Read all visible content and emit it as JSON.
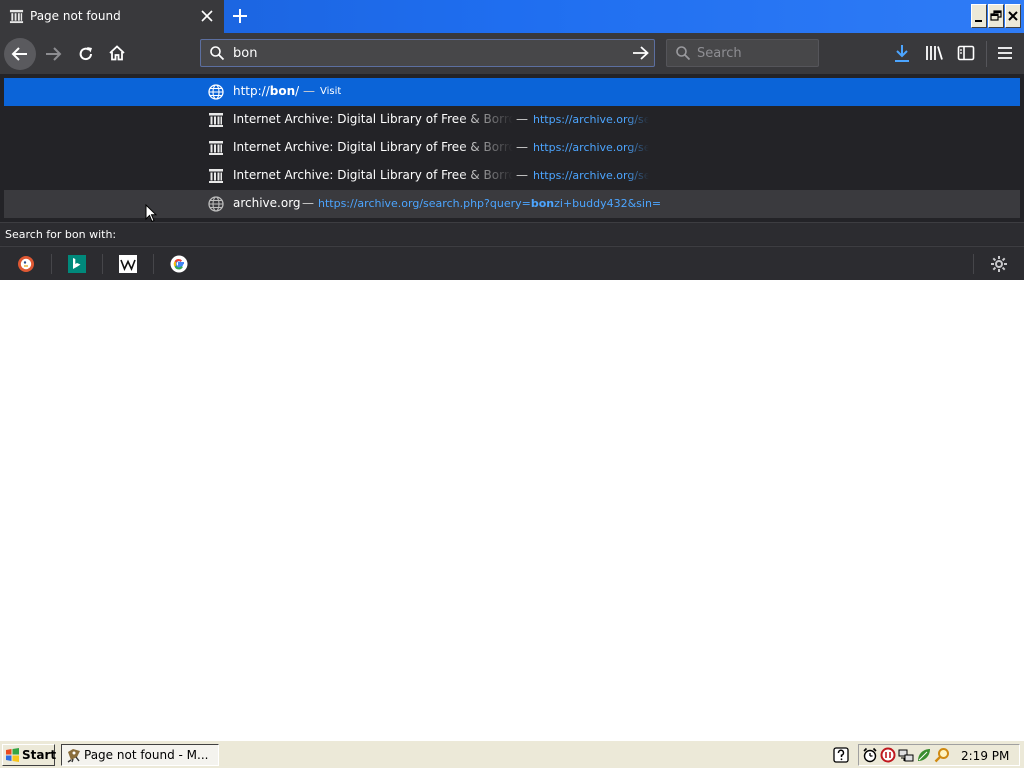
{
  "tab": {
    "title": "Page not found",
    "favicon": "archive-building-icon"
  },
  "window_controls": [
    "minimize",
    "restore",
    "close"
  ],
  "urlbar": {
    "value": "bon"
  },
  "searchbar": {
    "placeholder": "Search"
  },
  "suggestions": [
    {
      "icon": "globe-icon",
      "title_prefix": "http://",
      "title_bold": "bon",
      "title_suffix": "/",
      "sep": "—",
      "action": "Visit",
      "selected": true
    },
    {
      "icon": "archive-building-icon",
      "title": "Internet Archive: Digital Library of Free & Borrow",
      "sep": "—",
      "url": "https://archive.org/sea"
    },
    {
      "icon": "archive-building-icon",
      "title": "Internet Archive: Digital Library of Free & Borrow",
      "sep": "—",
      "url": "https://archive.org/sea"
    },
    {
      "icon": "archive-building-icon",
      "title": "Internet Archive: Digital Library of Free & Borrow",
      "sep": "—",
      "url": "https://archive.org/sea"
    },
    {
      "icon": "globe-icon",
      "title": "archive.org",
      "sep": "—",
      "url_prefix": "https://archive.org/search.php?query=",
      "url_bold": "bon",
      "url_suffix": "zi+buddy432&sin=",
      "hover": true
    }
  ],
  "search_with": {
    "label": "Search for bon with:",
    "engines": [
      "duckduckgo",
      "bing",
      "wikipedia",
      "google"
    ]
  },
  "taskbar": {
    "start_label": "Start",
    "task_label": "Page not found - M...",
    "clock": "2:19 PM"
  },
  "colors": {
    "tabstrip": "#1f6ef0",
    "toolbar": "#39393c",
    "dropdown": "#232327",
    "selected_row": "#0b64d8",
    "url_text": "#4ca5ff",
    "taskbar": "#ece9d8"
  }
}
